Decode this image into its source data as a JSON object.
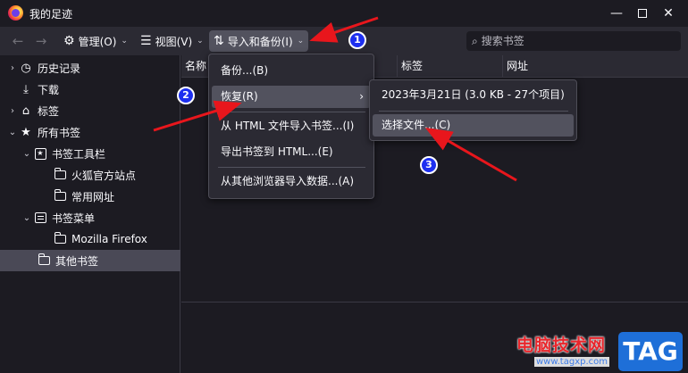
{
  "window": {
    "title": "我的足迹",
    "controls": [
      "—",
      "✕"
    ]
  },
  "toolbar": {
    "back_icon": "←",
    "forward_icon": "→",
    "manage_label": "管理(O)",
    "view_label": "视图(V)",
    "import_label": "导入和备份(I)",
    "chevron": "⌄",
    "search_placeholder": "搜索书签"
  },
  "sidebar": {
    "items": [
      {
        "label": "历史记录",
        "icon": "clock-icon"
      },
      {
        "label": "下载",
        "icon": "download-icon"
      },
      {
        "label": "标签",
        "icon": "tag-icon"
      },
      {
        "label": "所有书签",
        "icon": "star-icon"
      },
      {
        "label": "书签工具栏",
        "icon": "bookmarks-toolbar-icon"
      },
      {
        "label": "火狐官方站点",
        "icon": "folder-icon"
      },
      {
        "label": "常用网址",
        "icon": "folder-icon"
      },
      {
        "label": "书签菜单",
        "icon": "bookmarks-menu-icon"
      },
      {
        "label": "Mozilla Firefox",
        "icon": "folder-icon"
      },
      {
        "label": "其他书签",
        "icon": "folder-icon"
      }
    ]
  },
  "columns": {
    "name": "名称",
    "tags": "标签",
    "url": "网址"
  },
  "import_menu": {
    "items": [
      "备份...(B)",
      "恢复(R)",
      "从 HTML 文件导入书签...(I)",
      "导出书签到 HTML...(E)",
      "从其他浏览器导入数据...(A)"
    ],
    "submenu_arrow": "›"
  },
  "restore_submenu": {
    "items": [
      "2023年3月21日 (3.0 KB - 27个项目)",
      "选择文件...(C)"
    ]
  },
  "annotations": {
    "badges": [
      "1",
      "2",
      "3"
    ],
    "arrow_color": "#e8161c",
    "badge_color": "#1d2ff0"
  },
  "watermark": {
    "text": "电脑技术网",
    "url": "www.tagxp.com",
    "tag": "TAG"
  },
  "colors": {
    "background": "#1c1b22",
    "toolbar": "#2b2a33",
    "menu_hover": "#52525e",
    "text": "#fbfbfe"
  }
}
